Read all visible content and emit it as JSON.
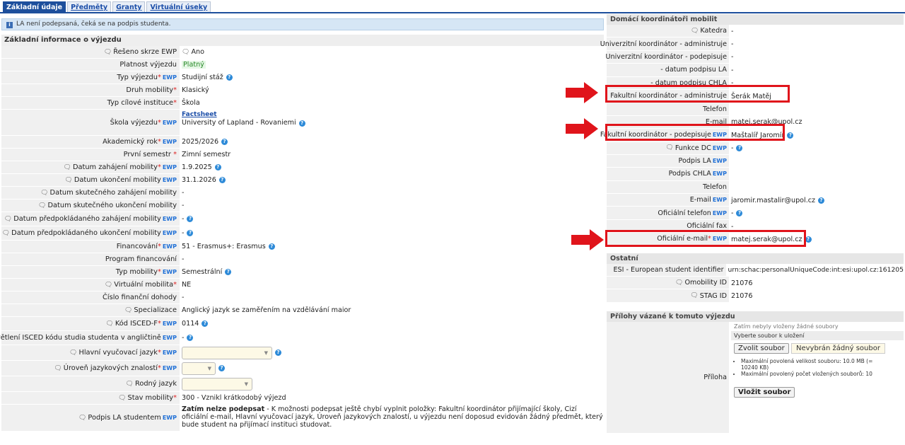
{
  "tabs": [
    "Základní údaje",
    "Předměty",
    "Granty",
    "Virtuální úseky"
  ],
  "info_bar": "LA není podepsaná, čeká se na podpis studenta.",
  "left": {
    "section_title": "Základní informace o výjezdu",
    "rows": [
      {
        "label": "Řešeno skrze EWP",
        "value": "Ano"
      },
      {
        "label": "Platnost výjezdu",
        "value": "Platný"
      },
      {
        "label": "Typ výjezdu",
        "value": "Studijní stáž"
      },
      {
        "label": "Druh mobility",
        "value": "Klasický"
      },
      {
        "label": "Typ cílové instituce",
        "value": "Škola"
      },
      {
        "label": "Škola výjezdu",
        "link": "Factsheet",
        "value": "University of Lapland - Rovaniemi"
      },
      {
        "label": "Akademický rok",
        "value": "2025/2026"
      },
      {
        "label": "První semestr",
        "value": "Zimní semestr"
      },
      {
        "label": "Datum zahájení mobility",
        "value": "1.9.2025"
      },
      {
        "label": "Datum ukončení mobility",
        "value": "31.1.2026"
      },
      {
        "label": "Datum skutečného zahájení mobility",
        "value": "-"
      },
      {
        "label": "Datum skutečného ukončení mobility",
        "value": "-"
      },
      {
        "label": "Datum předpokládaného zahájení mobility",
        "value": "-"
      },
      {
        "label": "Datum předpokládaného ukončení mobility",
        "value": "-"
      },
      {
        "label": "Financování",
        "value": "51 - Erasmus+: Erasmus"
      },
      {
        "label": "Program financování",
        "value": "-"
      },
      {
        "label": "Typ mobility",
        "value": "Semestrální"
      },
      {
        "label": "Virtuální mobilita",
        "value": "NE"
      },
      {
        "label": "Číslo finanční dohody",
        "value": "-"
      },
      {
        "label": "Specializace",
        "value": "Anglický jazyk se zaměřením na vzdělávání maior"
      },
      {
        "label": "Kód ISCED-F",
        "value": "0114"
      },
      {
        "label": "Vysvětlení ISCED kódu studia studenta v angličtině",
        "value": "-"
      },
      {
        "label": "Hlavní vyučovací jazyk",
        "value": ""
      },
      {
        "label": "Úroveň jazykových znalostí",
        "value": ""
      },
      {
        "label": "Rodný jazyk",
        "value": ""
      },
      {
        "label": "Stav mobility",
        "value": "300 - Vznikl krátkodobý výjezd"
      },
      {
        "label": "Podpis LA studentem",
        "value_bold": "Zatím nelze podepsat",
        "value": " - K možnosti podepsat ještě chybí vyplnit položky: Fakultní koordinátor přijímající školy, Cizí oficiální e-mail, Hlavní vyučovací jazyk, Úroveň jazykových znalostí, u výjezdu není doposud evidován žádný předmět, který bude student na přijímací instituci studovat."
      }
    ]
  },
  "right": {
    "coord_title": "Domácí koordinátoři mobilit",
    "coord_rows": [
      {
        "label": "Katedra",
        "value": "-"
      },
      {
        "label": "Univerzitní koordinátor - administruje",
        "value": "-"
      },
      {
        "label": "Univerzitní koordinátor - podepisuje",
        "value": "-"
      },
      {
        "label": "- datum podpisu LA",
        "value": "-"
      },
      {
        "label": "- datum podpisu CHLA",
        "value": "-"
      },
      {
        "label": "Fakultní koordinátor - administruje",
        "value": "Šerák Matěj"
      },
      {
        "label": "Telefon",
        "value": ""
      },
      {
        "label": "E-mail",
        "value": "matej.serak@upol.cz"
      },
      {
        "label": "Fakultní koordinátor - podepisuje",
        "value": "Maštalíř Jaromír"
      },
      {
        "label": "Funkce DC",
        "value": "-"
      },
      {
        "label": "Podpis LA",
        "value": ""
      },
      {
        "label": "Podpis CHLA",
        "value": ""
      },
      {
        "label": "Telefon",
        "value": ""
      },
      {
        "label": "E-mail",
        "value": "jaromir.mastalir@upol.cz"
      },
      {
        "label": "Oficiální telefon",
        "value": "-"
      },
      {
        "label": "Oficiální fax",
        "value": "-"
      },
      {
        "label": "Oficiální e-mail",
        "value": "matej.serak@upol.cz"
      }
    ],
    "other_title": "Ostatní",
    "other_rows": [
      {
        "label": "ESI - European student identifier",
        "value": "urn:schac:personalUniqueCode:int:esi:upol.cz:161205"
      },
      {
        "label": "Omobility ID",
        "value": "21076"
      },
      {
        "label": "STAG ID",
        "value": "21076"
      }
    ],
    "attach_title": "Přílohy vázané k tomuto výjezdu",
    "attach_label": "Příloha",
    "no_files": "Zatím nebyly vloženy žádné soubory",
    "choose_file_header": "Vyberte soubor k uložení",
    "choose_btn": "Zvolit soubor",
    "no_file_chosen": "Nevybrán žádný soubor",
    "limit1": "Maximální povolená velikost souboru: 10.0 MB (= 10240 KB)",
    "limit2": "Maximální povolený počet vložených souborů: 10",
    "insert_btn": "Vložit soubor"
  },
  "colors": {
    "accent": "#1d4f9c",
    "highlight": "#e0141b",
    "ewp": "#1e6fd6"
  }
}
